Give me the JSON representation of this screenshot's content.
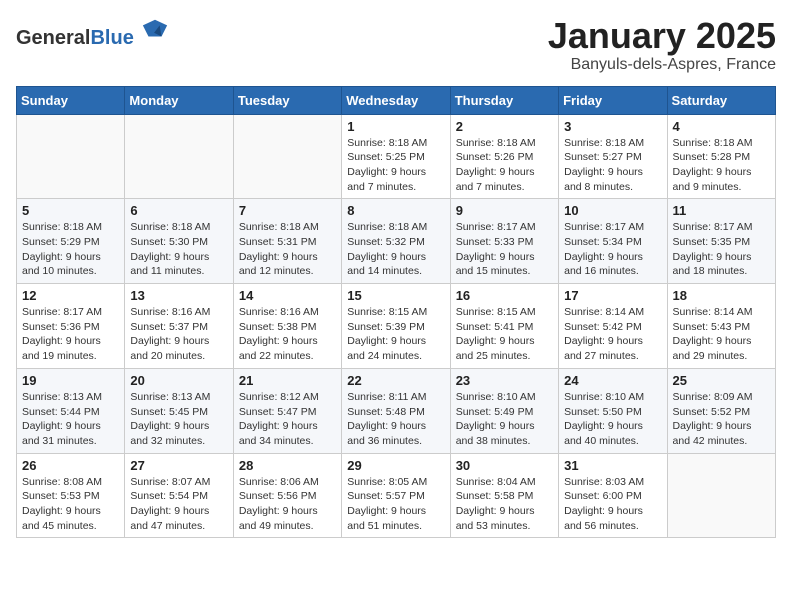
{
  "header": {
    "logo_general": "General",
    "logo_blue": "Blue",
    "month_title": "January 2025",
    "location": "Banyuls-dels-Aspres, France"
  },
  "weekdays": [
    "Sunday",
    "Monday",
    "Tuesday",
    "Wednesday",
    "Thursday",
    "Friday",
    "Saturday"
  ],
  "weeks": [
    [
      {
        "day": "",
        "sunrise": "",
        "sunset": "",
        "daylight": ""
      },
      {
        "day": "",
        "sunrise": "",
        "sunset": "",
        "daylight": ""
      },
      {
        "day": "",
        "sunrise": "",
        "sunset": "",
        "daylight": ""
      },
      {
        "day": "1",
        "sunrise": "Sunrise: 8:18 AM",
        "sunset": "Sunset: 5:25 PM",
        "daylight": "Daylight: 9 hours and 7 minutes."
      },
      {
        "day": "2",
        "sunrise": "Sunrise: 8:18 AM",
        "sunset": "Sunset: 5:26 PM",
        "daylight": "Daylight: 9 hours and 7 minutes."
      },
      {
        "day": "3",
        "sunrise": "Sunrise: 8:18 AM",
        "sunset": "Sunset: 5:27 PM",
        "daylight": "Daylight: 9 hours and 8 minutes."
      },
      {
        "day": "4",
        "sunrise": "Sunrise: 8:18 AM",
        "sunset": "Sunset: 5:28 PM",
        "daylight": "Daylight: 9 hours and 9 minutes."
      }
    ],
    [
      {
        "day": "5",
        "sunrise": "Sunrise: 8:18 AM",
        "sunset": "Sunset: 5:29 PM",
        "daylight": "Daylight: 9 hours and 10 minutes."
      },
      {
        "day": "6",
        "sunrise": "Sunrise: 8:18 AM",
        "sunset": "Sunset: 5:30 PM",
        "daylight": "Daylight: 9 hours and 11 minutes."
      },
      {
        "day": "7",
        "sunrise": "Sunrise: 8:18 AM",
        "sunset": "Sunset: 5:31 PM",
        "daylight": "Daylight: 9 hours and 12 minutes."
      },
      {
        "day": "8",
        "sunrise": "Sunrise: 8:18 AM",
        "sunset": "Sunset: 5:32 PM",
        "daylight": "Daylight: 9 hours and 14 minutes."
      },
      {
        "day": "9",
        "sunrise": "Sunrise: 8:17 AM",
        "sunset": "Sunset: 5:33 PM",
        "daylight": "Daylight: 9 hours and 15 minutes."
      },
      {
        "day": "10",
        "sunrise": "Sunrise: 8:17 AM",
        "sunset": "Sunset: 5:34 PM",
        "daylight": "Daylight: 9 hours and 16 minutes."
      },
      {
        "day": "11",
        "sunrise": "Sunrise: 8:17 AM",
        "sunset": "Sunset: 5:35 PM",
        "daylight": "Daylight: 9 hours and 18 minutes."
      }
    ],
    [
      {
        "day": "12",
        "sunrise": "Sunrise: 8:17 AM",
        "sunset": "Sunset: 5:36 PM",
        "daylight": "Daylight: 9 hours and 19 minutes."
      },
      {
        "day": "13",
        "sunrise": "Sunrise: 8:16 AM",
        "sunset": "Sunset: 5:37 PM",
        "daylight": "Daylight: 9 hours and 20 minutes."
      },
      {
        "day": "14",
        "sunrise": "Sunrise: 8:16 AM",
        "sunset": "Sunset: 5:38 PM",
        "daylight": "Daylight: 9 hours and 22 minutes."
      },
      {
        "day": "15",
        "sunrise": "Sunrise: 8:15 AM",
        "sunset": "Sunset: 5:39 PM",
        "daylight": "Daylight: 9 hours and 24 minutes."
      },
      {
        "day": "16",
        "sunrise": "Sunrise: 8:15 AM",
        "sunset": "Sunset: 5:41 PM",
        "daylight": "Daylight: 9 hours and 25 minutes."
      },
      {
        "day": "17",
        "sunrise": "Sunrise: 8:14 AM",
        "sunset": "Sunset: 5:42 PM",
        "daylight": "Daylight: 9 hours and 27 minutes."
      },
      {
        "day": "18",
        "sunrise": "Sunrise: 8:14 AM",
        "sunset": "Sunset: 5:43 PM",
        "daylight": "Daylight: 9 hours and 29 minutes."
      }
    ],
    [
      {
        "day": "19",
        "sunrise": "Sunrise: 8:13 AM",
        "sunset": "Sunset: 5:44 PM",
        "daylight": "Daylight: 9 hours and 31 minutes."
      },
      {
        "day": "20",
        "sunrise": "Sunrise: 8:13 AM",
        "sunset": "Sunset: 5:45 PM",
        "daylight": "Daylight: 9 hours and 32 minutes."
      },
      {
        "day": "21",
        "sunrise": "Sunrise: 8:12 AM",
        "sunset": "Sunset: 5:47 PM",
        "daylight": "Daylight: 9 hours and 34 minutes."
      },
      {
        "day": "22",
        "sunrise": "Sunrise: 8:11 AM",
        "sunset": "Sunset: 5:48 PM",
        "daylight": "Daylight: 9 hours and 36 minutes."
      },
      {
        "day": "23",
        "sunrise": "Sunrise: 8:10 AM",
        "sunset": "Sunset: 5:49 PM",
        "daylight": "Daylight: 9 hours and 38 minutes."
      },
      {
        "day": "24",
        "sunrise": "Sunrise: 8:10 AM",
        "sunset": "Sunset: 5:50 PM",
        "daylight": "Daylight: 9 hours and 40 minutes."
      },
      {
        "day": "25",
        "sunrise": "Sunrise: 8:09 AM",
        "sunset": "Sunset: 5:52 PM",
        "daylight": "Daylight: 9 hours and 42 minutes."
      }
    ],
    [
      {
        "day": "26",
        "sunrise": "Sunrise: 8:08 AM",
        "sunset": "Sunset: 5:53 PM",
        "daylight": "Daylight: 9 hours and 45 minutes."
      },
      {
        "day": "27",
        "sunrise": "Sunrise: 8:07 AM",
        "sunset": "Sunset: 5:54 PM",
        "daylight": "Daylight: 9 hours and 47 minutes."
      },
      {
        "day": "28",
        "sunrise": "Sunrise: 8:06 AM",
        "sunset": "Sunset: 5:56 PM",
        "daylight": "Daylight: 9 hours and 49 minutes."
      },
      {
        "day": "29",
        "sunrise": "Sunrise: 8:05 AM",
        "sunset": "Sunset: 5:57 PM",
        "daylight": "Daylight: 9 hours and 51 minutes."
      },
      {
        "day": "30",
        "sunrise": "Sunrise: 8:04 AM",
        "sunset": "Sunset: 5:58 PM",
        "daylight": "Daylight: 9 hours and 53 minutes."
      },
      {
        "day": "31",
        "sunrise": "Sunrise: 8:03 AM",
        "sunset": "Sunset: 6:00 PM",
        "daylight": "Daylight: 9 hours and 56 minutes."
      },
      {
        "day": "",
        "sunrise": "",
        "sunset": "",
        "daylight": ""
      }
    ]
  ]
}
